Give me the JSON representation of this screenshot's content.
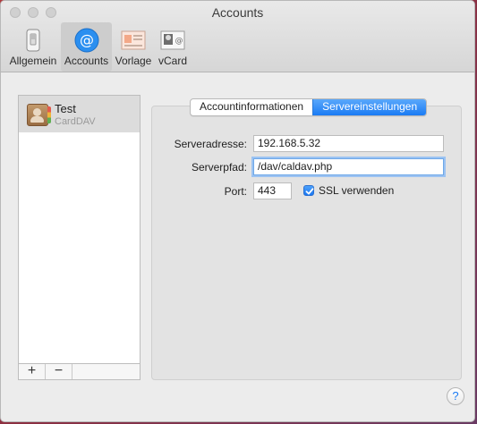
{
  "window": {
    "title": "Accounts"
  },
  "toolbar": {
    "items": [
      {
        "label": "Allgemein",
        "icon": "switch-icon"
      },
      {
        "label": "Accounts",
        "icon": "at-sign-icon"
      },
      {
        "label": "Vorlage",
        "icon": "template-icon"
      },
      {
        "label": "vCard",
        "icon": "vcard-icon"
      }
    ]
  },
  "accounts": {
    "items": [
      {
        "name": "Test",
        "type": "CardDAV"
      }
    ],
    "add_label": "+",
    "remove_label": "−"
  },
  "tabs": {
    "info": "Accountinformationen",
    "server": "Servereinstellungen"
  },
  "server": {
    "address_label": "Serveradresse:",
    "address_value": "192.168.5.32",
    "path_label": "Serverpfad:",
    "path_value": "/dav/caldav.php",
    "port_label": "Port:",
    "port_value": "443",
    "ssl_label": "SSL verwenden",
    "ssl_checked": true
  },
  "help": {
    "label": "?"
  },
  "colors": {
    "accent": "#1a7bf4"
  }
}
